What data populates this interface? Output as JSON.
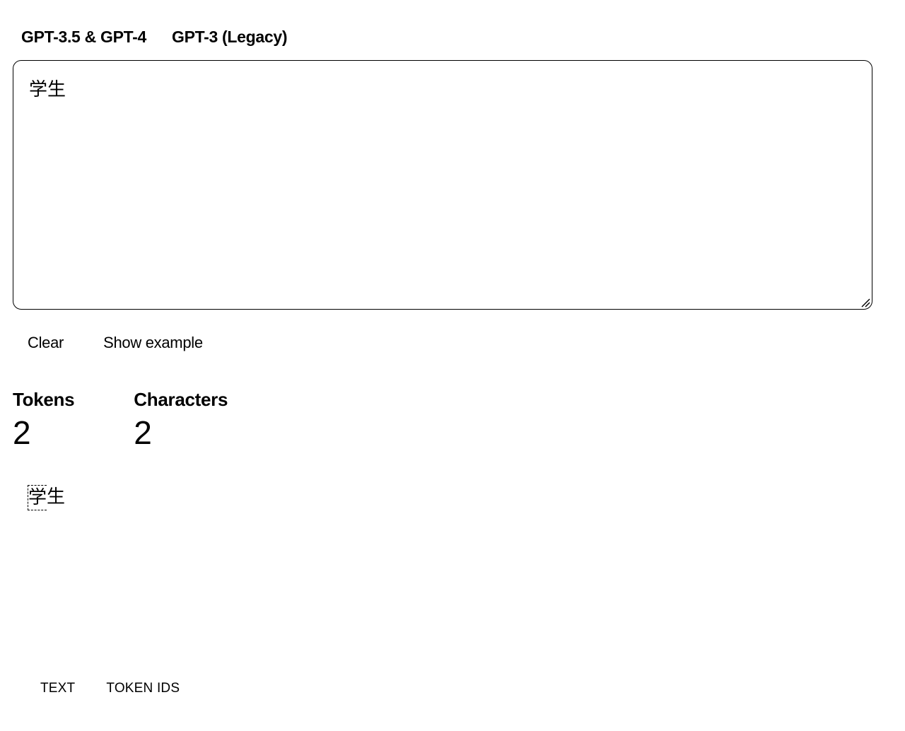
{
  "model_tabs": [
    {
      "label": "GPT-3.5 & GPT-4"
    },
    {
      "label": "GPT-3 (Legacy)"
    }
  ],
  "editor": {
    "value": "学生"
  },
  "actions": {
    "clear_label": "Clear",
    "show_example_label": "Show example"
  },
  "stats": {
    "tokens_label": "Tokens",
    "tokens_value": "2",
    "characters_label": "Characters",
    "characters_value": "2"
  },
  "tokens": [
    "学",
    "生"
  ],
  "view_tabs": {
    "text_label": "TEXT",
    "token_ids_label": "TOKEN IDS"
  }
}
